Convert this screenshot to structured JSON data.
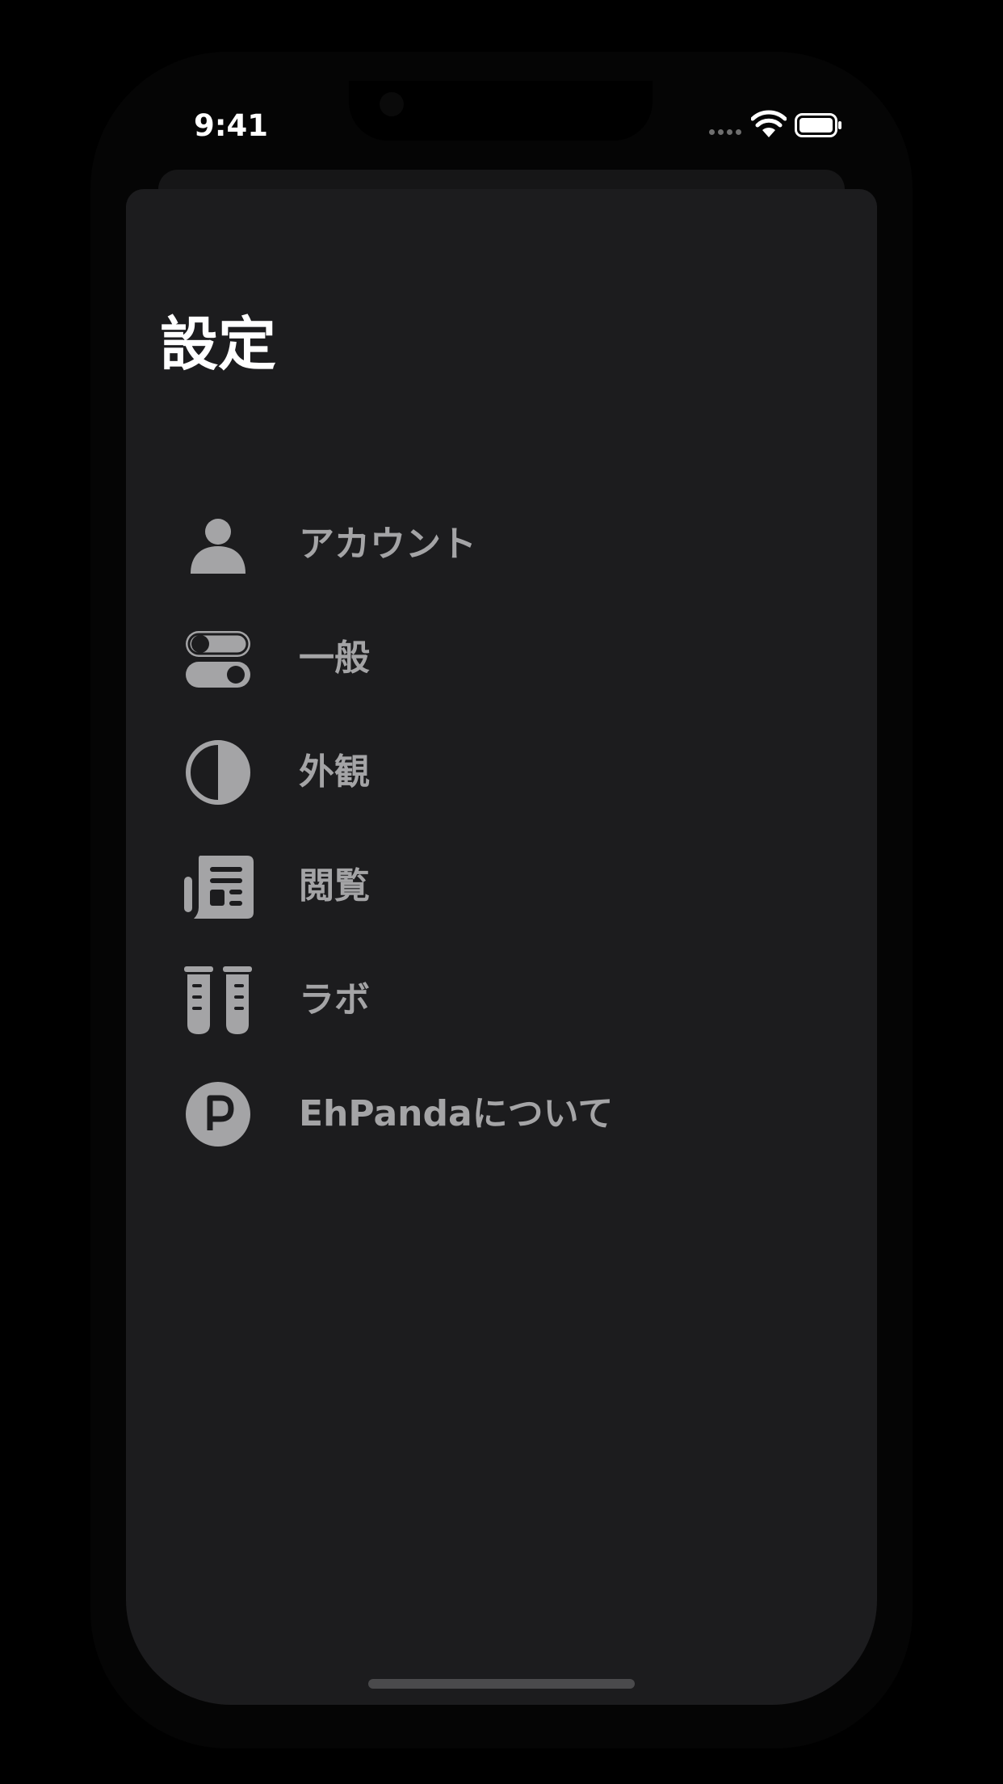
{
  "status_bar": {
    "time": "9:41",
    "icons": [
      "cellular-signal-icon",
      "wifi-icon",
      "battery-icon"
    ]
  },
  "page": {
    "title": "設定"
  },
  "menu": {
    "items": [
      {
        "label": "アカウント",
        "icon": "person-icon"
      },
      {
        "label": "一般",
        "icon": "switches-icon"
      },
      {
        "label": "外観",
        "icon": "half-circle-icon"
      },
      {
        "label": "閲覧",
        "icon": "newspaper-icon"
      },
      {
        "label": "ラボ",
        "icon": "test-tubes-icon"
      },
      {
        "label": "EhPandaについて",
        "icon": "p-circle-icon"
      }
    ]
  },
  "colors": {
    "background": "#000000",
    "sheet": "#1c1c1e",
    "title": "#ffffff",
    "item_text": "#a4a4a6",
    "icon": "#a4a4a6"
  }
}
